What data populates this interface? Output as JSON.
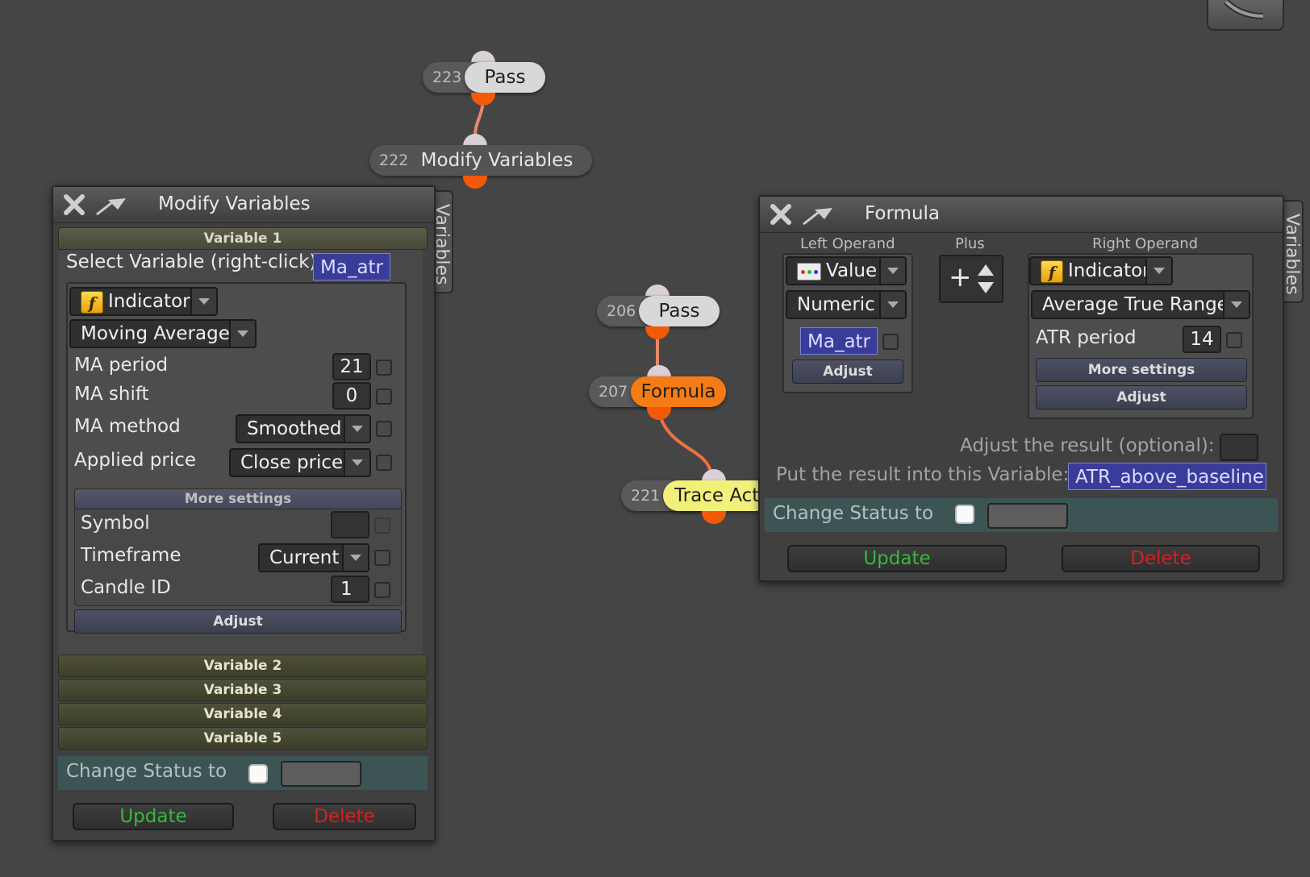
{
  "canvas": {
    "nodes": [
      {
        "id": "223",
        "name": "Pass"
      },
      {
        "id": "222",
        "name": "Modify Variables"
      },
      {
        "id": "206",
        "name": "Pass"
      },
      {
        "id": "207",
        "name": "Formula"
      },
      {
        "id": "221",
        "name": "Trace Act"
      }
    ]
  },
  "modify_window": {
    "title": "Modify Variables",
    "side_tab": "Variables",
    "variable1_header": "Variable 1",
    "select_label": "Select Variable (right-click)",
    "selected_variable": "Ma_atr",
    "source_type": "Indicator",
    "indicator": "Moving Average",
    "params": [
      {
        "label": "MA period",
        "value": "21"
      },
      {
        "label": "MA shift",
        "value": "0"
      },
      {
        "label": "MA method",
        "value": "Smoothed"
      },
      {
        "label": "Applied price",
        "value": "Close price"
      }
    ],
    "more_settings": "More settings",
    "symbol_label": "Symbol",
    "symbol_value": "",
    "timeframe_label": "Timeframe",
    "timeframe_value": "Current",
    "candle_label": "Candle ID",
    "candle_value": "1",
    "adjust": "Adjust",
    "variables_closed": [
      "Variable 2",
      "Variable 3",
      "Variable 4",
      "Variable 5"
    ],
    "change_status_label": "Change Status to",
    "update": "Update",
    "delete": "Delete"
  },
  "formula_window": {
    "title": "Formula",
    "side_tab": "Variables",
    "left_operand_label": "Left Operand",
    "operator_label": "Plus",
    "right_operand_label": "Right Operand",
    "left": {
      "type": "Value",
      "subtype": "Numeric",
      "variable": "Ma_atr",
      "adjust": "Adjust"
    },
    "operator_symbol": "+",
    "right": {
      "type": "Indicator",
      "indicator": "Average True Range",
      "param_label": "ATR period",
      "param_value": "14",
      "more_settings": "More settings",
      "adjust": "Adjust"
    },
    "adjust_result_label": "Adjust the result (optional):",
    "result_variable_label": "Put the result into this Variable:",
    "result_variable": "ATR_above_baseline",
    "change_status_label": "Change Status to",
    "update": "Update",
    "delete": "Delete"
  },
  "colors": {
    "background": "#454545",
    "link": "#f25a08",
    "variable_box": "#3a3c9a",
    "status_bar": "#3d5454",
    "update_text": "#38b83c",
    "delete_text": "#d81f1f"
  }
}
